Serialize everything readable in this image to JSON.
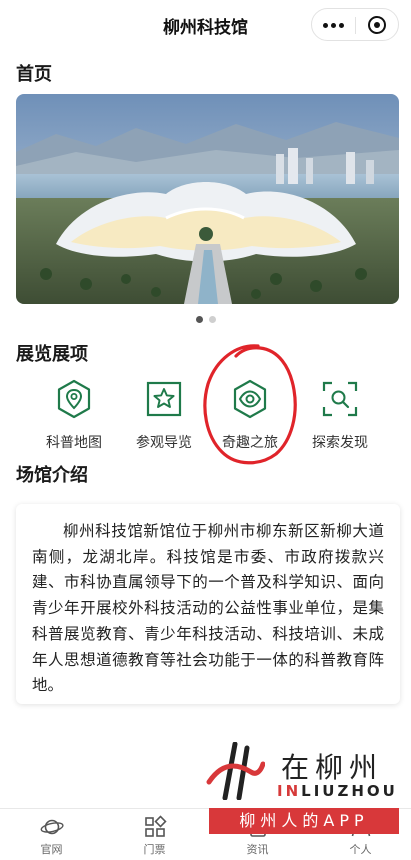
{
  "nav": {
    "title": "柳州科技馆"
  },
  "home": {
    "title": "首页"
  },
  "banner": {
    "dots": 2,
    "active_index": 0
  },
  "exhibits": {
    "title": "展览展项",
    "items": [
      {
        "label": "科普地图",
        "icon": "map-pin-hexagon-icon"
      },
      {
        "label": "参观导览",
        "icon": "star-square-icon"
      },
      {
        "label": "奇趣之旅",
        "icon": "eye-hexagon-icon"
      },
      {
        "label": "探索发现",
        "icon": "scan-search-icon"
      }
    ]
  },
  "venue": {
    "title": "场馆介绍",
    "text": "柳州科技馆新馆位于柳州市柳东新区新柳大道南侧，龙湖北岸。科技馆是市委、市政府拨款兴建、市科协直属领导下的一个普及科学知识、面向青少年开展校外科技活动的公益性事业单位，是集科普展览教育、青少年科技活动、科技培训、未成年人思想道德教育等社会功能于一体的科普教育阵地。"
  },
  "watermark": {
    "main": "在柳州",
    "sub_accent": "IN",
    "sub_rest": "LIUZHOU",
    "bar": "柳州人的APP"
  },
  "tabs": [
    {
      "label": "官网",
      "icon": "planet-icon"
    },
    {
      "label": "门票",
      "icon": "grid-icon"
    },
    {
      "label": "资讯",
      "icon": "document-icon"
    },
    {
      "label": "个人",
      "icon": "user-icon"
    }
  ],
  "colors": {
    "accent": "#1f7a4a",
    "annotation": "#e0242a",
    "watermark": "#d8383a"
  }
}
